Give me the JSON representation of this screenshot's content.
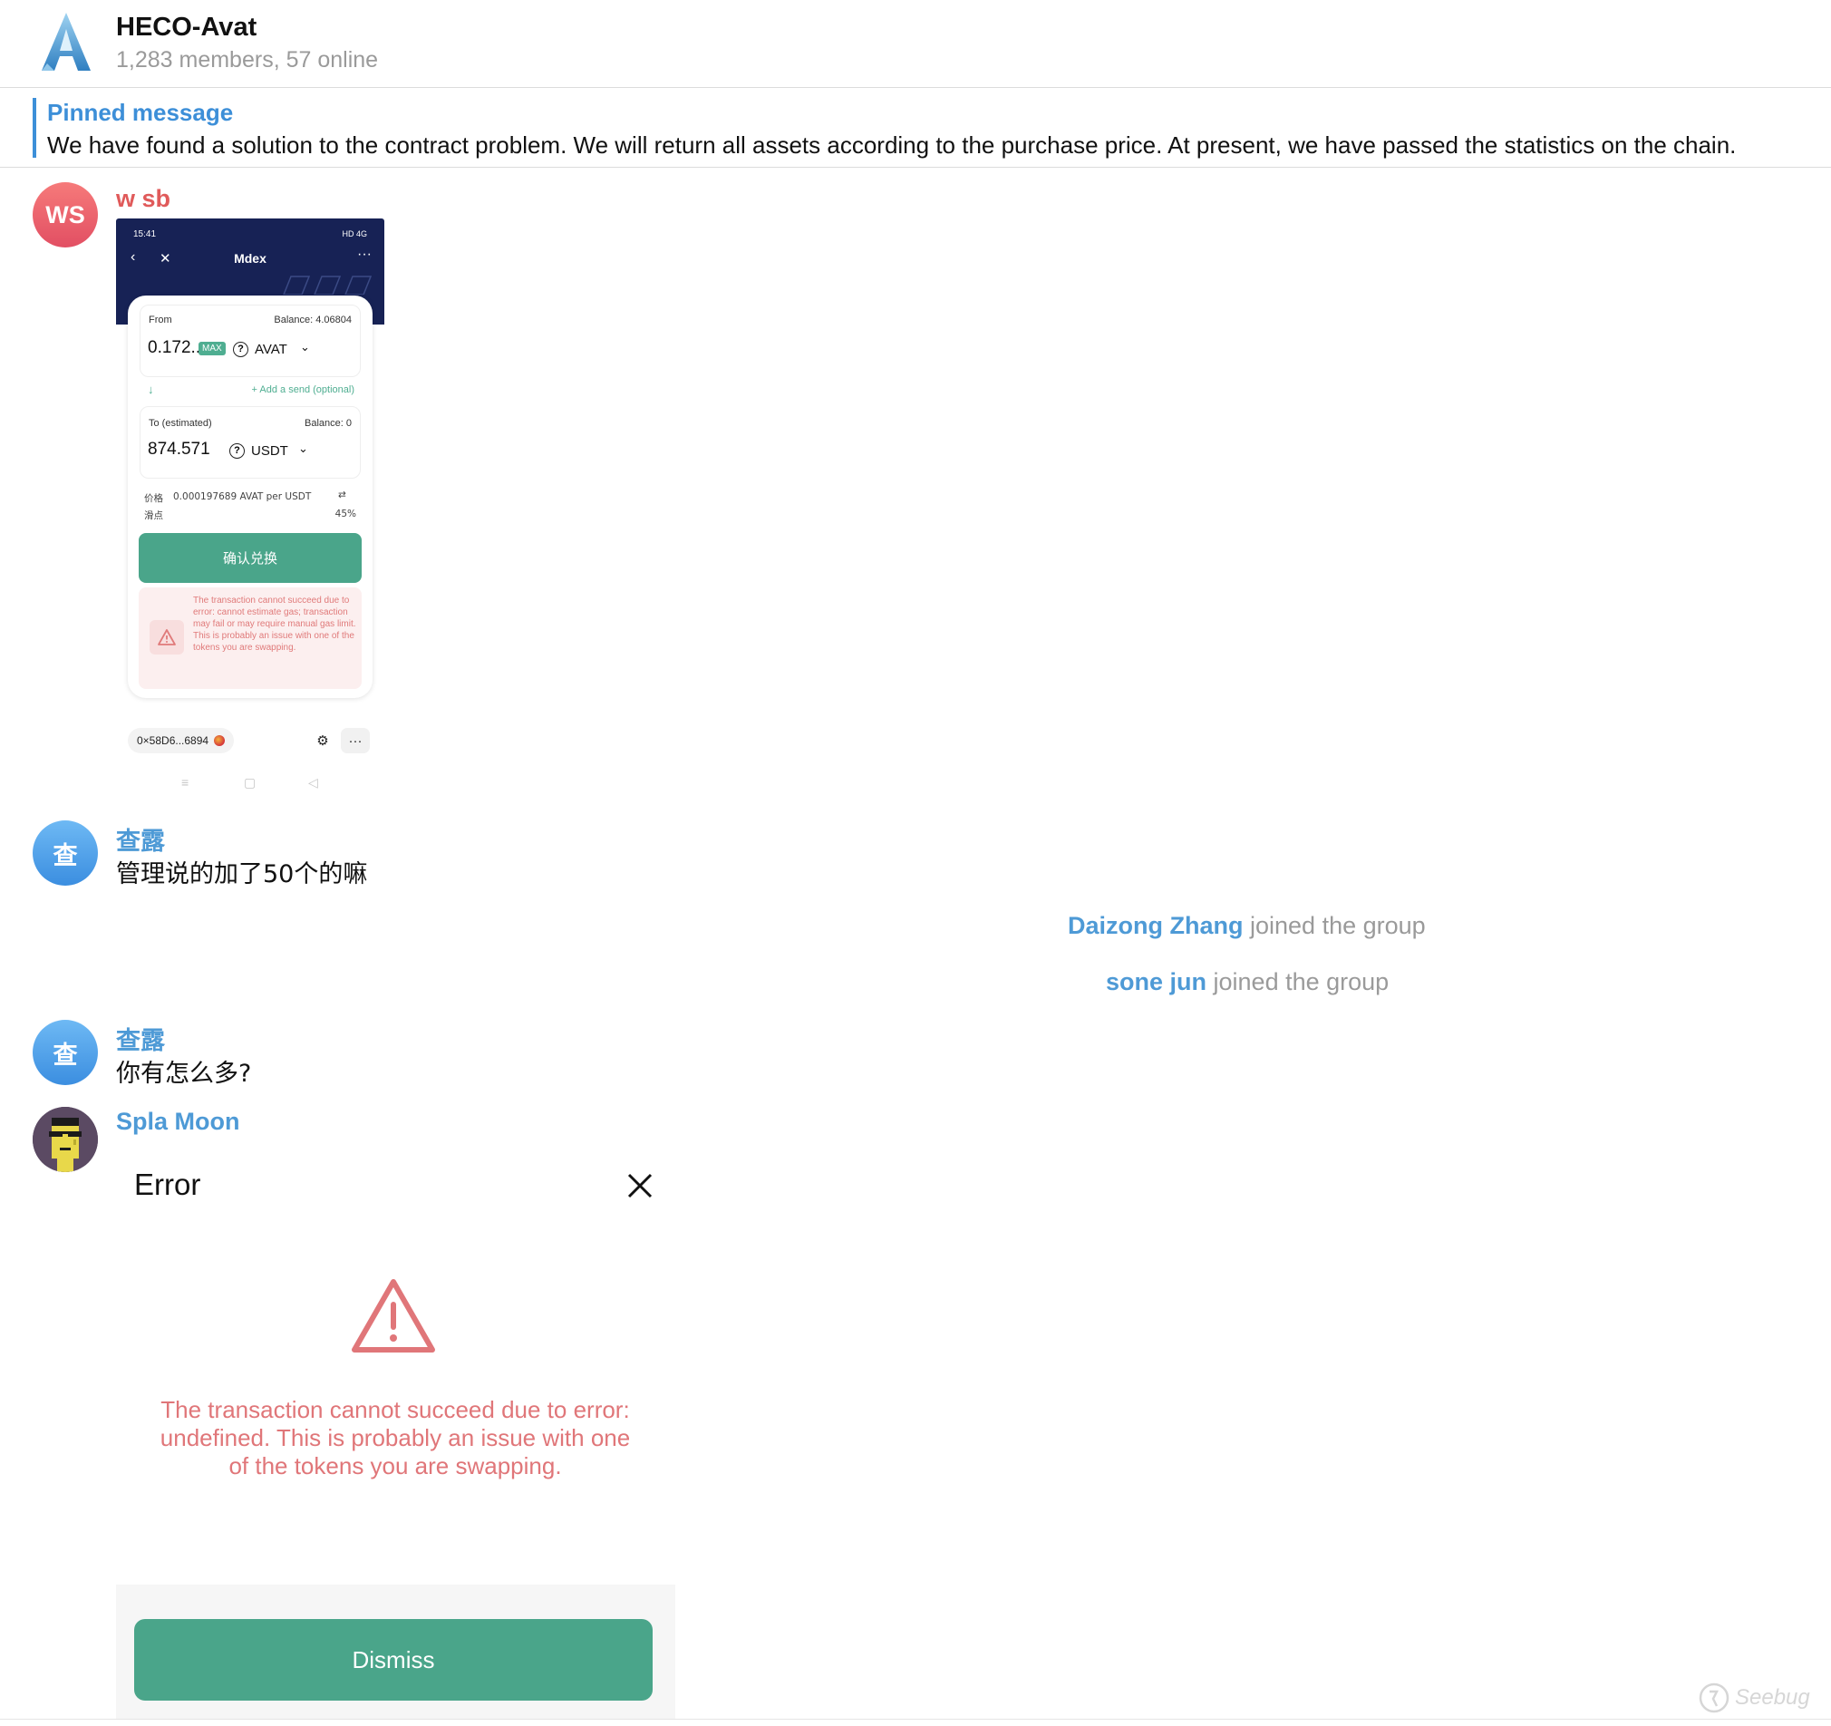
{
  "header": {
    "title": "HECO-Avat",
    "subtitle": "1,283 members, 57 online"
  },
  "pinned": {
    "title": "Pinned message",
    "text": "We have found a solution to the contract problem. We will return all assets according to the purchase price. At present, we have passed the statistics on the chain."
  },
  "messages": {
    "m1": {
      "avatar": "WS",
      "sender": "w sb"
    },
    "m2": {
      "avatar": "查",
      "sender": "查露",
      "text": "管理说的加了50个的嘛"
    },
    "m3": {
      "avatar": "查",
      "sender": "查露",
      "text": "你有怎么多?"
    },
    "m4": {
      "sender": "Spla Moon"
    }
  },
  "system": [
    {
      "name": "Daizong Zhang",
      "action": "joined the group"
    },
    {
      "name": "sone jun",
      "action": "joined the group"
    }
  ],
  "phone": {
    "time": "15:41",
    "status_right": "HD 4G",
    "title": "Mdex",
    "from_label": "From",
    "from_balance": "Balance: 4.06804",
    "from_amount": "0.172...",
    "max": "MAX",
    "from_token": "AVAT",
    "add_send": "+ Add a send (optional)",
    "to_label": "To (estimated)",
    "to_balance": "Balance: 0",
    "to_amount": "874.571",
    "to_token": "USDT",
    "price_label": "价格",
    "price_value": "0.000197689 AVAT per USDT",
    "slip_label": "滑点",
    "slip_value": "45%",
    "confirm": "确认兑换",
    "error": "The transaction cannot succeed due to error: cannot estimate gas; transaction may fail or may require manual gas limit. This is probably an issue with one of the tokens you are swapping.",
    "address": "0×58D6...6894"
  },
  "error_dialog": {
    "title": "Error",
    "message": "The transaction cannot succeed due to error: undefined. This is probably an issue with one of the tokens you are swapping.",
    "dismiss": "Dismiss"
  },
  "watermark": "Seebug",
  "colors": {
    "link_blue": "#3d8fd8",
    "sender_red": "#e05a5a",
    "sender_blue": "#4e9ad6",
    "green_button": "#4aa58a",
    "error_red": "#e07679"
  }
}
